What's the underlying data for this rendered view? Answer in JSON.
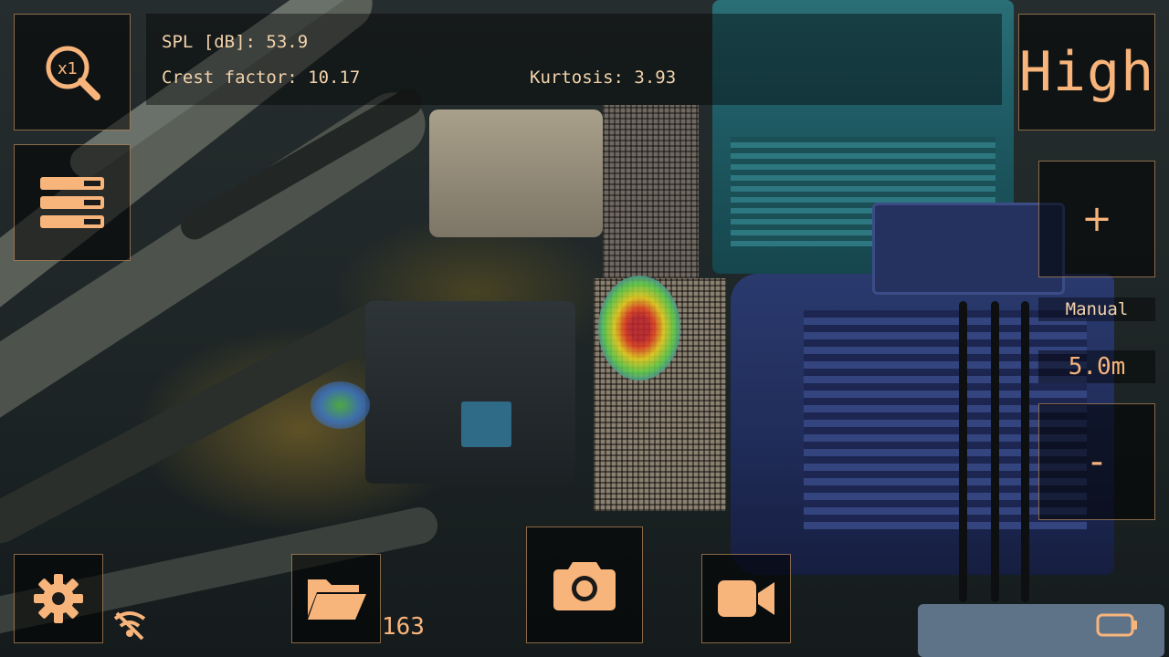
{
  "stats": {
    "spl": "SPL [dB]: 53.9",
    "crest_factor": "Crest factor: 10.17",
    "kurtosis": "Kurtosis: 3.93"
  },
  "zoom": {
    "icon": "zoom-x1-icon",
    "text": "x1"
  },
  "menu": {
    "icon": "menu-list-icon"
  },
  "sensitivity": {
    "label": "High"
  },
  "distance": {
    "plus_label": "+",
    "minus_label": "-",
    "mode_label": "Manual",
    "value": "5.0m"
  },
  "bottom_bar": {
    "settings_icon": "gear-icon",
    "gallery_icon": "folder-open-icon",
    "gallery_count": "163",
    "capture_icon": "camera-icon",
    "record_icon": "video-camera-icon",
    "signal_icon": "signal-off-icon",
    "battery_icon": "battery-icon"
  },
  "colors": {
    "accent": "#f7b47b",
    "text": "#f2d3ac",
    "panel_bg": "rgba(0,0,0,0.55)"
  }
}
